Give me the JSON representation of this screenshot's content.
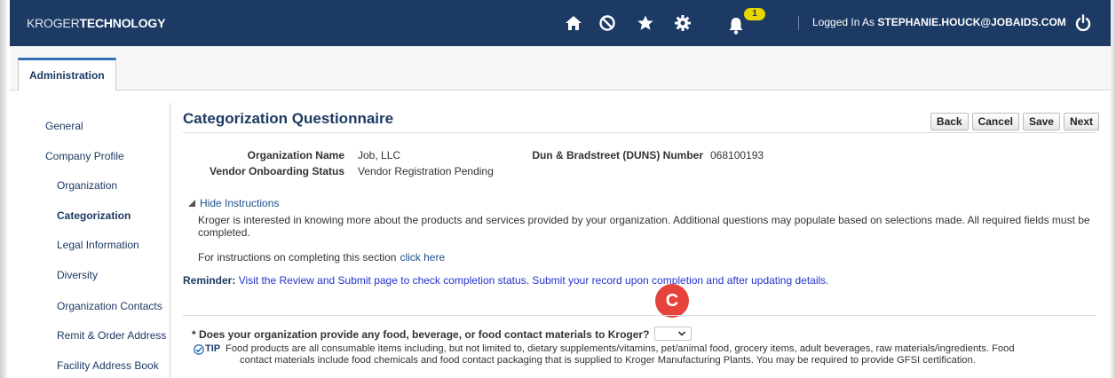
{
  "header": {
    "brand_thin": "KROGER",
    "brand_bold": "TECHNOLOGY",
    "icons": [
      "home-icon",
      "no-entry-icon",
      "star-icon",
      "gear-icon",
      "bell-icon",
      "power-icon"
    ],
    "notification_count": "1",
    "logged_in_prefix": "Logged In As",
    "logged_in_user": "STEPHANIE.HOUCK@JOBAIDS.COM",
    "color": "#1c3a63"
  },
  "tabs": [
    {
      "label": "Administration",
      "active": true
    }
  ],
  "sidebar": {
    "items": [
      {
        "label": "General"
      },
      {
        "label": "Company Profile"
      },
      {
        "label": "Organization"
      },
      {
        "label": "Categorization",
        "selected": true
      },
      {
        "label": "Legal Information"
      },
      {
        "label": "Diversity"
      },
      {
        "label": "Organization Contacts"
      },
      {
        "label": "Remit & Order Address"
      },
      {
        "label": "Facility Address Book"
      }
    ]
  },
  "main": {
    "title": "Categorization Questionnaire",
    "buttons": {
      "back": "Back",
      "cancel": "Cancel",
      "save": "Save",
      "next": "Next"
    },
    "fields": {
      "org_name_label": "Organization Name",
      "org_name_value": "Job, LLC",
      "status_label": "Vendor Onboarding Status",
      "status_value": "Vendor Registration Pending",
      "duns_label": "Dun & Bradstreet (DUNS) Number",
      "duns_value": "068100193"
    },
    "hide_instructions": "Hide Instructions",
    "instructions": "Kroger is interested in knowing more about the products and services provided by your organization. Additional questions may populate based on selections made. All required fields must be completed.",
    "for_instructions": "For instructions on completing this section",
    "click_here": "click here",
    "reminder_label": "Reminder:",
    "reminder_text": "Visit the Review and Submit page to check completion status. Submit your record upon completion and after updating details.",
    "marker": "C",
    "question": "* Does your organization provide any food, beverage, or food contact materials to Kroger?",
    "question_value": "",
    "tip_label": "TIP",
    "tip_line1": "Food products are all consumable items including, but not limited to, dietary supplements/vitamins, pet/animal food, grocery items, adult beverages, raw materials/ingredients. Food",
    "tip_line2": "contact materials include food chemicals and food contact packaging that is supplied to Kroger Manufacturing Plants. You may be required to provide GFSI certification."
  },
  "colors": {
    "marker": "#e5433c",
    "badge": "#e8d600",
    "link": "#1c4f8c",
    "reminder": "#2233cc"
  }
}
